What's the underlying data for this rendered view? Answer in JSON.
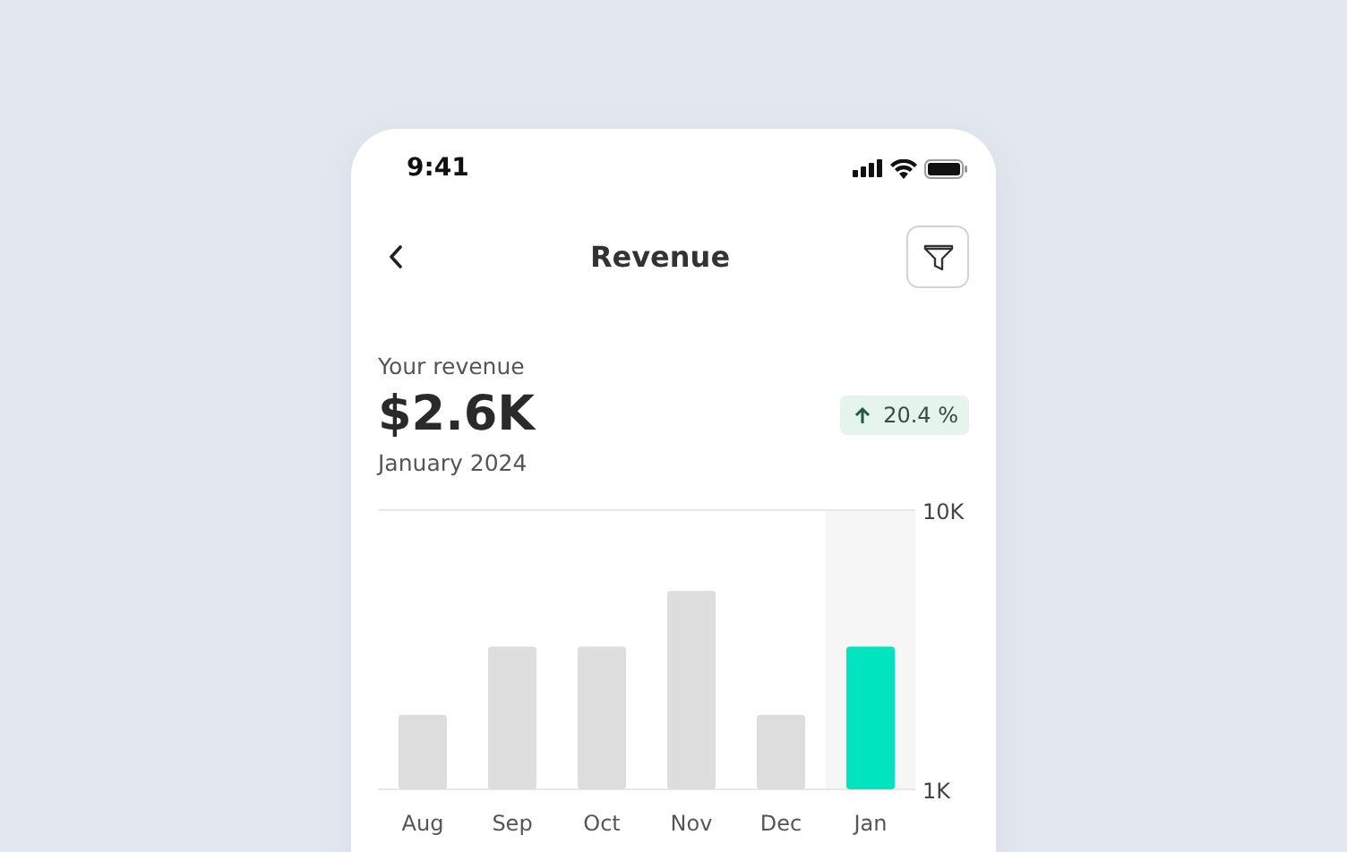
{
  "status_bar": {
    "time": "9:41"
  },
  "header": {
    "title": "Revenue"
  },
  "summary": {
    "label": "Your revenue",
    "amount": "$2.6K",
    "period": "January 2024",
    "change": "20.4 %",
    "rising": true
  },
  "chart": {
    "chart_data": {
      "type": "bar",
      "categories": [
        "Aug",
        "Sep",
        "Oct",
        "Nov",
        "Dec",
        "Jan"
      ],
      "series": [
        {
          "color": "#f6f6f6",
          "values": [
            null,
            null,
            null,
            null,
            null,
            10000
          ]
        },
        {
          "color": "#dddddd",
          "values": [
            3400,
            5600,
            5600,
            7400,
            3400,
            null
          ]
        },
        {
          "color": "#00e5bf",
          "values": [
            null,
            null,
            null,
            null,
            null,
            5600
          ]
        }
      ],
      "ylim": [
        1000,
        10000
      ],
      "yticks": [
        {
          "value": 1000,
          "label": "1K"
        },
        {
          "value": 10000,
          "label": "10K"
        }
      ]
    }
  }
}
